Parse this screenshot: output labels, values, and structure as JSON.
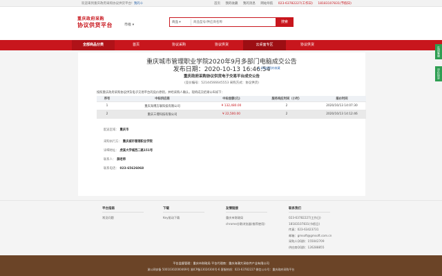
{
  "topbar": {
    "welcome": "欢迎来到重庆政府采购协议供货平台!",
    "login": "我的十",
    "links": [
      "首页",
      "我的收藏",
      "我的消息",
      "网站导航"
    ],
    "phone1": "023-63782227(工作日)",
    "phone2": "18183107831(节假日)"
  },
  "header": {
    "logo_line1": "重庆政府采购",
    "logo_line2": "协议供货平台",
    "city": "市级",
    "search_scope": "商品",
    "search_placeholder": "商品型号/供应商名称",
    "search_button": "搜索"
  },
  "nav": {
    "category": "全部商品分类",
    "items": [
      "首页",
      "协议采购",
      "协议供货",
      "云桌面专区",
      "协议供货"
    ]
  },
  "main": {
    "title": "重庆城市管理职业学院2020年9月多部门电脑成交公告",
    "date": "发布日期：2020-10-13 16:46:54",
    "favorite": "添加到我的收藏",
    "subtitle": "重庆政府采购协议供货电子交易平台成交公告",
    "meta": "(竞价编号：52144566645553   采购方式：协议供货)",
    "intro": "按照重庆政府采购协议供货电子交易平台的竞价原则，并经采购人确认，现将成交结果公布如下：",
    "table": {
      "headers": [
        "序号",
        "中标供应商",
        "中标金额(元)",
        "服务响应时间（小时）",
        "报价时间"
      ],
      "rows": [
        [
          "1",
          "重庆海博方联科技有限公司",
          "¥ 132,480.00",
          "2",
          "2020/10/13 14:07:30"
        ],
        [
          "2",
          "重庆三增科技有限公司",
          "¥ 22,500.00",
          "2",
          "2020/10/13 14:12:46"
        ]
      ]
    },
    "details": {
      "region_k": "配送区域：",
      "region_v": "重庆市",
      "buyer_k": "采购执行方：",
      "buyer_v": "重庆城市管理职业学院",
      "address_k": "详细地址：",
      "address_v": "虎溪大学城西二路151号",
      "contact_k": "联系人：",
      "contact_v": "薛老师",
      "phone_k": "联系电话：",
      "phone_v": "023-65626068"
    }
  },
  "footer": {
    "col1": {
      "title": "平台指南",
      "items": [
        "常见问题"
      ]
    },
    "col2": {
      "title": "下载",
      "items": [
        "Key驱动下载"
      ]
    },
    "col3": {
      "title": "友情链接",
      "items": [
        "重庆市财政局",
        "chrome谷歌浏览器(推荐使用)"
      ]
    },
    "col4": {
      "title": "联系我们",
      "items": [
        "023-63782227(工作日)",
        "18183107831(节假日)",
        "传真：023-63423731",
        "邮箱：gmsoft@gmsoft.com.cn",
        "采购人QQ群：155042709",
        "供应商QQ群：126288855"
      ]
    }
  },
  "bottom": {
    "line1": "平台监督管理：重庆市财政局   平台代理商：重庆海潮大采软件产业有限公司",
    "line2": "渝公网安备 50010302000469号   渝ICP备13024304号-6  客服热线：023-63782227  微信公众号：重庆政府采购平台"
  },
  "side": [
    "在线客服",
    "评价投诉"
  ],
  "colors": {
    "brand_red": "#c8161d",
    "footer_brown": "#6b4427",
    "side_green": "#2e9e52"
  }
}
